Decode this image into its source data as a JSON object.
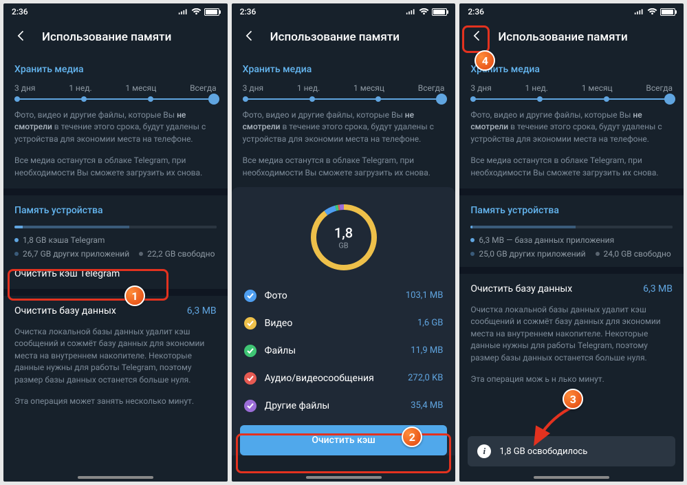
{
  "status": {
    "time": "2:36"
  },
  "header": {
    "title": "Использование памяти"
  },
  "media": {
    "section": "Хранить медиа",
    "opts": [
      "3 дня",
      "1 нед.",
      "1 месяц",
      "Всегда"
    ],
    "desc1a": "Фото, видео и другие файлы, которые Вы ",
    "desc1b": "не смотрели",
    "desc1c": " в течение этого срока, будут удалены с устройства для экономии места на телефоне.",
    "desc2": "Все медиа останутся в облаке Telegram, при необходимости Вы сможете загрузить их снова."
  },
  "storage": {
    "section": "Память устройства",
    "s1": {
      "legend": [
        "1,8 GB кэша Telegram",
        "26,7 GB других приложений",
        "22,2 GB свободно"
      ],
      "clear_cache": "Очистить кэш Telegram"
    },
    "s3": {
      "legend": [
        "6,3 MB — база данных приложения",
        "25,0 GB других приложений",
        "24,0 GB свободно"
      ]
    }
  },
  "db": {
    "action": "Очистить базу данных",
    "size": "6,3 MB",
    "desc1": "Очистка локальной базы данных удалит кэш сообщений и сожмёт базу данных для экономии места на внутреннем накопителе. Некоторые данные нужны для работы Telegram, поэтому размер базы данных останется больше нуля.",
    "desc2": "Эта операция может занять несколько минут.",
    "desc2_cut": "Эта операция мож               ь н            лько минут."
  },
  "sheet": {
    "total_val": "1,8",
    "total_unit": "GB",
    "rows": [
      {
        "color": "#4e9ef0",
        "label": "Фото",
        "size": "103,1 MB"
      },
      {
        "color": "#eec04a",
        "label": "Видео",
        "size": "1,6 GB"
      },
      {
        "color": "#3fc574",
        "label": "Файлы",
        "size": "11,9 MB"
      },
      {
        "color": "#e65a52",
        "label": "Аудио/видеосообщения",
        "size": "272,0 KB"
      },
      {
        "color": "#9c6dd8",
        "label": "Другие файлы",
        "size": "35,4 MB"
      }
    ],
    "button": "Очистить кэш"
  },
  "toast": {
    "text": "1,8 GB освободилось"
  },
  "markers": {
    "m1": "1",
    "m2": "2",
    "m3": "3",
    "m4": "4"
  }
}
